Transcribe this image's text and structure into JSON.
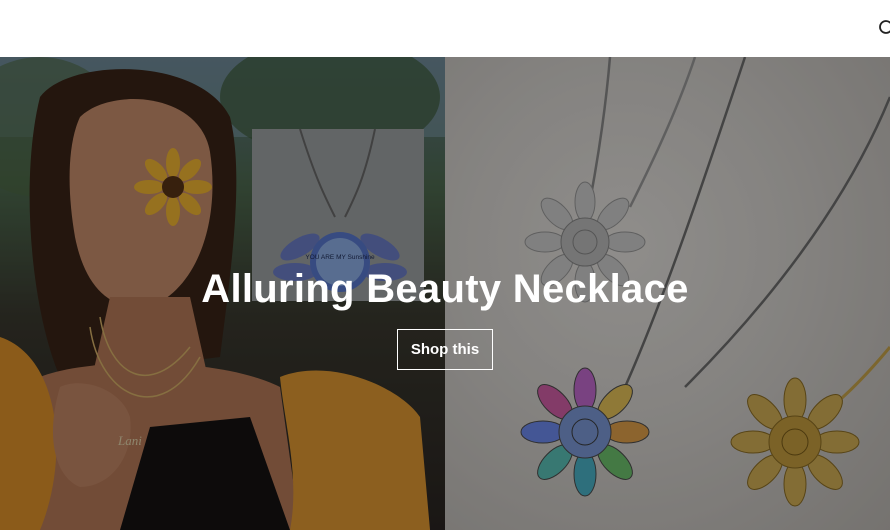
{
  "header": {
    "search_icon": "search-icon"
  },
  "hero": {
    "title": "Alluring Beauty Necklace",
    "cta_label": "Shop this",
    "pendant_text": "YOU ARE MY Sunshine",
    "bracelet_text": "Lani"
  }
}
